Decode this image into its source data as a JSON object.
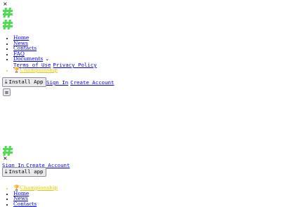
{
  "top": {
    "close_glyph": "×",
    "nav": {
      "home": "Home",
      "news": "News",
      "contacts": "Contacts",
      "faq": "FAQ",
      "documents": "Documents",
      "terms": "Terms of Use",
      "privacy": "Privacy Policy",
      "championship": "Championship"
    },
    "install_label": "Install App",
    "sign_in": "Sign In",
    "create_account": "Create Account",
    "menu_glyph": "≡"
  },
  "mobile": {
    "close_glyph": "×",
    "sign_in": "Sign In",
    "create_account": "Create Account",
    "install_label": "Install app",
    "nav": {
      "championship": "Championship",
      "home": "Home",
      "news": "News",
      "contacts": "Contacts"
    }
  },
  "icons": {
    "logo": "hash-logo-icon",
    "download": "download-icon",
    "trophy": "trophy-icon",
    "chevron": "chevron-down-icon",
    "menu": "hamburger-menu-icon"
  },
  "colors": {
    "logo_green": "#4ddc52",
    "link": "#0000ee",
    "championship": "#e6c800"
  }
}
